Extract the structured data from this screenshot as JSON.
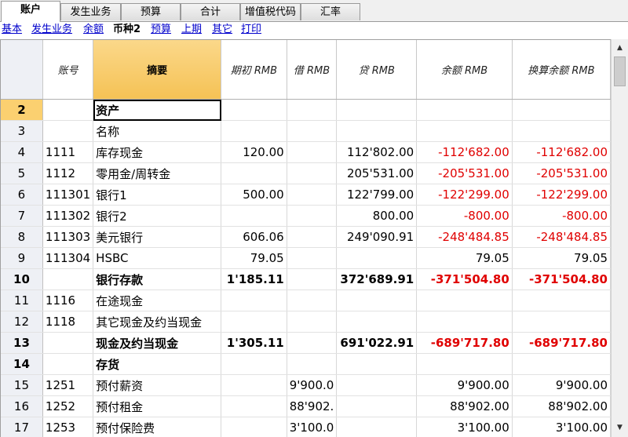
{
  "tabs": [
    "账户",
    "发生业务",
    "预算",
    "合计",
    "增值税代码",
    "汇率"
  ],
  "subtabs": [
    "基本",
    "发生业务",
    "余额",
    "币种2",
    "预算",
    "上期",
    "其它",
    "打印"
  ],
  "columns": [
    "",
    "账号",
    "摘要",
    "期初 RMB",
    "借 RMB",
    "贷 RMB",
    "余额 RMB",
    "换算余额 RMB"
  ],
  "rows": [
    {
      "n": "2",
      "account": "",
      "desc": "资产",
      "open": "",
      "debit": "",
      "credit": "",
      "bal": "",
      "conv": ""
    },
    {
      "n": "3",
      "account": "",
      "desc": "名称",
      "open": "",
      "debit": "",
      "credit": "",
      "bal": "",
      "conv": ""
    },
    {
      "n": "4",
      "account": "1111",
      "desc": "库存现金",
      "open": "120.00",
      "debit": "",
      "credit": "112'802.00",
      "bal": "-112'682.00",
      "conv": "-112'682.00"
    },
    {
      "n": "5",
      "account": "1112",
      "desc": "零用金/周转金",
      "open": "",
      "debit": "",
      "credit": "205'531.00",
      "bal": "-205'531.00",
      "conv": "-205'531.00"
    },
    {
      "n": "6",
      "account": "111301",
      "desc": "银行1",
      "open": "500.00",
      "debit": "",
      "credit": "122'799.00",
      "bal": "-122'299.00",
      "conv": "-122'299.00"
    },
    {
      "n": "7",
      "account": "111302",
      "desc": "银行2",
      "open": "",
      "debit": "",
      "credit": "800.00",
      "bal": "-800.00",
      "conv": "-800.00"
    },
    {
      "n": "8",
      "account": "111303",
      "desc": "美元银行",
      "open": "606.06",
      "debit": "",
      "credit": "249'090.91",
      "bal": "-248'484.85",
      "conv": "-248'484.85"
    },
    {
      "n": "9",
      "account": "111304",
      "desc": "HSBC",
      "open": "79.05",
      "debit": "",
      "credit": "",
      "bal": "79.05",
      "conv": "79.05"
    },
    {
      "n": "10",
      "account": "",
      "desc": "银行存款",
      "open": "1'185.11",
      "debit": "",
      "credit": "372'689.91",
      "bal": "-371'504.80",
      "conv": "-371'504.80"
    },
    {
      "n": "11",
      "account": "1116",
      "desc": "在途现金",
      "open": "",
      "debit": "",
      "credit": "",
      "bal": "",
      "conv": ""
    },
    {
      "n": "12",
      "account": "1118",
      "desc": "其它现金及约当现金",
      "open": "",
      "debit": "",
      "credit": "",
      "bal": "",
      "conv": ""
    },
    {
      "n": "13",
      "account": "",
      "desc": "现金及约当现金",
      "open": "1'305.11",
      "debit": "",
      "credit": "691'022.91",
      "bal": "-689'717.80",
      "conv": "-689'717.80"
    },
    {
      "n": "14",
      "account": "",
      "desc": "存货",
      "open": "",
      "debit": "",
      "credit": "",
      "bal": "",
      "conv": ""
    },
    {
      "n": "15",
      "account": "1251",
      "desc": "预付薪资",
      "open": "",
      "debit": "9'900.0",
      "credit": "",
      "bal": "9'900.00",
      "conv": "9'900.00"
    },
    {
      "n": "16",
      "account": "1252",
      "desc": "预付租金",
      "open": "",
      "debit": "88'902.",
      "credit": "",
      "bal": "88'902.00",
      "conv": "88'902.00"
    },
    {
      "n": "17",
      "account": "1253",
      "desc": "预付保险费",
      "open": "",
      "debit": "3'100.0",
      "credit": "",
      "bal": "3'100.00",
      "conv": "3'100.00"
    }
  ],
  "colors": {
    "negative": "#e00000",
    "header_accent": "#f5c255",
    "selected_row": "#fbd070",
    "link": "#0000cc"
  }
}
